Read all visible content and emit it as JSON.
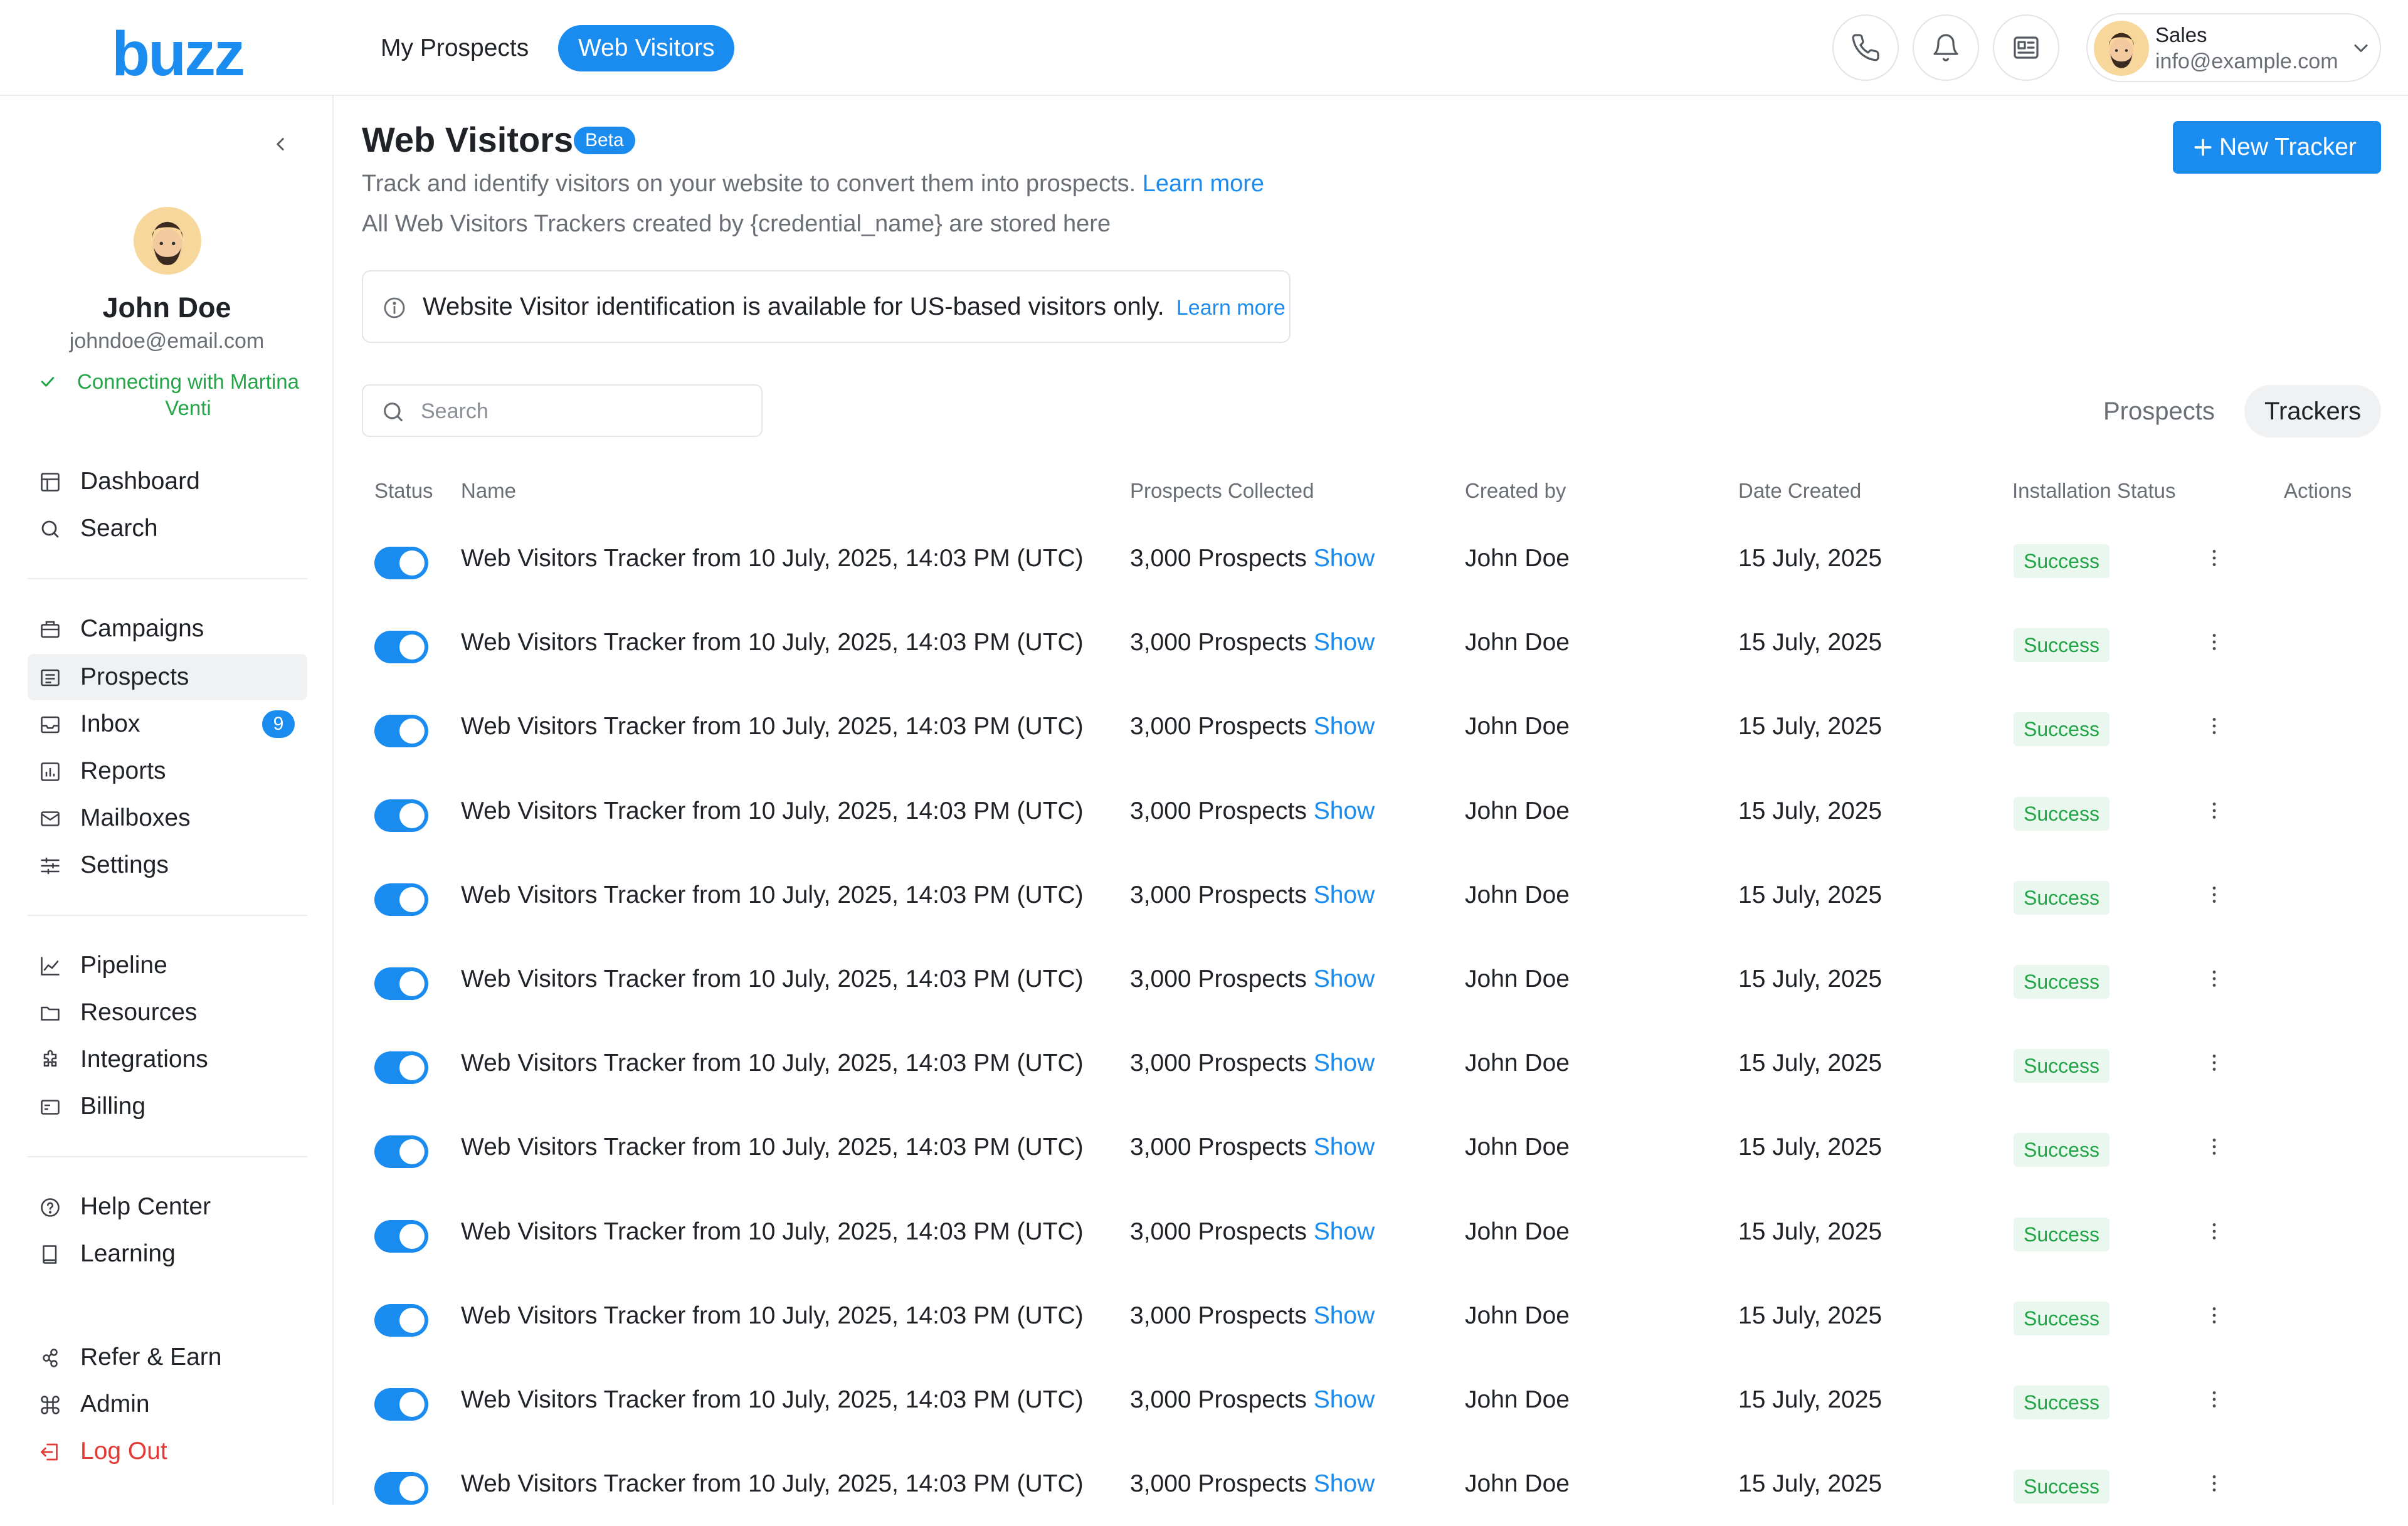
{
  "header": {
    "logo": "buzz",
    "tabs": [
      {
        "label": "My Prospects",
        "active": false
      },
      {
        "label": "Web Visitors",
        "active": true
      }
    ],
    "user": {
      "role": "Sales",
      "email": "info@example.com"
    }
  },
  "sidebar": {
    "profile": {
      "name": "John Doe",
      "email": "johndoe@email.com",
      "status": "Connecting with Martina Venti"
    },
    "items": [
      {
        "label": "Dashboard",
        "icon": "dashboard-icon"
      },
      {
        "label": "Search",
        "icon": "search-icon"
      },
      {
        "label": "Campaigns",
        "icon": "campaigns-icon"
      },
      {
        "label": "Prospects",
        "icon": "prospects-icon",
        "active": true
      },
      {
        "label": "Inbox",
        "icon": "inbox-icon",
        "badge": "9"
      },
      {
        "label": "Reports",
        "icon": "reports-icon"
      },
      {
        "label": "Mailboxes",
        "icon": "mail-icon"
      },
      {
        "label": "Settings",
        "icon": "settings-icon"
      },
      {
        "label": "Pipeline",
        "icon": "pipeline-icon"
      },
      {
        "label": "Resources",
        "icon": "folder-icon"
      },
      {
        "label": "Integrations",
        "icon": "puzzle-icon"
      },
      {
        "label": "Billing",
        "icon": "billing-icon"
      },
      {
        "label": "Help Center",
        "icon": "help-icon"
      },
      {
        "label": "Learning",
        "icon": "book-icon"
      },
      {
        "label": "Refer & Earn",
        "icon": "refer-icon"
      },
      {
        "label": "Admin",
        "icon": "command-icon"
      },
      {
        "label": "Log Out",
        "icon": "logout-icon"
      }
    ]
  },
  "page": {
    "title": "Web Visitors",
    "badge": "Beta",
    "subtitle": "Track and identify visitors on your website to convert them into prospects.",
    "learn_more": "Learn more",
    "subtitle2": "All Web Visitors Trackers created by {credential_name} are stored here",
    "new_tracker": "New Tracker",
    "notice": "Website Visitor identification is available for US-based visitors only.",
    "notice_link": "Learn more",
    "search_placeholder": "Search",
    "view_tabs": [
      {
        "label": "Prospects",
        "active": false
      },
      {
        "label": "Trackers",
        "active": true
      }
    ]
  },
  "table": {
    "columns": [
      "Status",
      "Name",
      "Prospects Collected",
      "Created by",
      "Date Created",
      "Installation Status",
      "Actions"
    ],
    "rows": [
      {
        "enabled": true,
        "name": "Web Visitors Tracker from 10 July, 2025, 14:03 PM (UTC)",
        "prospects": "3,000 Prospects",
        "show": "Show",
        "created_by": "John Doe",
        "date": "15 July, 2025",
        "status": "Success"
      },
      {
        "enabled": true,
        "name": "Web Visitors Tracker from 10 July, 2025, 14:03 PM (UTC)",
        "prospects": "3,000 Prospects",
        "show": "Show",
        "created_by": "John Doe",
        "date": "15 July, 2025",
        "status": "Success"
      },
      {
        "enabled": true,
        "name": "Web Visitors Tracker from 10 July, 2025, 14:03 PM (UTC)",
        "prospects": "3,000 Prospects",
        "show": "Show",
        "created_by": "John Doe",
        "date": "15 July, 2025",
        "status": "Success"
      },
      {
        "enabled": true,
        "name": "Web Visitors Tracker from 10 July, 2025, 14:03 PM (UTC)",
        "prospects": "3,000 Prospects",
        "show": "Show",
        "created_by": "John Doe",
        "date": "15 July, 2025",
        "status": "Success"
      },
      {
        "enabled": true,
        "name": "Web Visitors Tracker from 10 July, 2025, 14:03 PM (UTC)",
        "prospects": "3,000 Prospects",
        "show": "Show",
        "created_by": "John Doe",
        "date": "15 July, 2025",
        "status": "Success"
      },
      {
        "enabled": true,
        "name": "Web Visitors Tracker from 10 July, 2025, 14:03 PM (UTC)",
        "prospects": "3,000 Prospects",
        "show": "Show",
        "created_by": "John Doe",
        "date": "15 July, 2025",
        "status": "Success"
      },
      {
        "enabled": true,
        "name": "Web Visitors Tracker from 10 July, 2025, 14:03 PM (UTC)",
        "prospects": "3,000 Prospects",
        "show": "Show",
        "created_by": "John Doe",
        "date": "15 July, 2025",
        "status": "Success"
      },
      {
        "enabled": true,
        "name": "Web Visitors Tracker from 10 July, 2025, 14:03 PM (UTC)",
        "prospects": "3,000 Prospects",
        "show": "Show",
        "created_by": "John Doe",
        "date": "15 July, 2025",
        "status": "Success"
      },
      {
        "enabled": true,
        "name": "Web Visitors Tracker from 10 July, 2025, 14:03 PM (UTC)",
        "prospects": "3,000 Prospects",
        "show": "Show",
        "created_by": "John Doe",
        "date": "15 July, 2025",
        "status": "Success"
      },
      {
        "enabled": true,
        "name": "Web Visitors Tracker from 10 July, 2025, 14:03 PM (UTC)",
        "prospects": "3,000 Prospects",
        "show": "Show",
        "created_by": "John Doe",
        "date": "15 July, 2025",
        "status": "Success"
      },
      {
        "enabled": true,
        "name": "Web Visitors Tracker from 10 July, 2025, 14:03 PM (UTC)",
        "prospects": "3,000 Prospects",
        "show": "Show",
        "created_by": "John Doe",
        "date": "15 July, 2025",
        "status": "Success"
      },
      {
        "enabled": true,
        "name": "Web Visitors Tracker from 10 July, 2025, 14:03 PM (UTC)",
        "prospects": "3,000 Prospects",
        "show": "Show",
        "created_by": "John Doe",
        "date": "15 July, 2025",
        "status": "Success"
      }
    ]
  },
  "colors": {
    "accent": "#1a8cf0",
    "success": "#22a447",
    "success_bg": "#e9f7ee",
    "danger": "#e53935"
  }
}
